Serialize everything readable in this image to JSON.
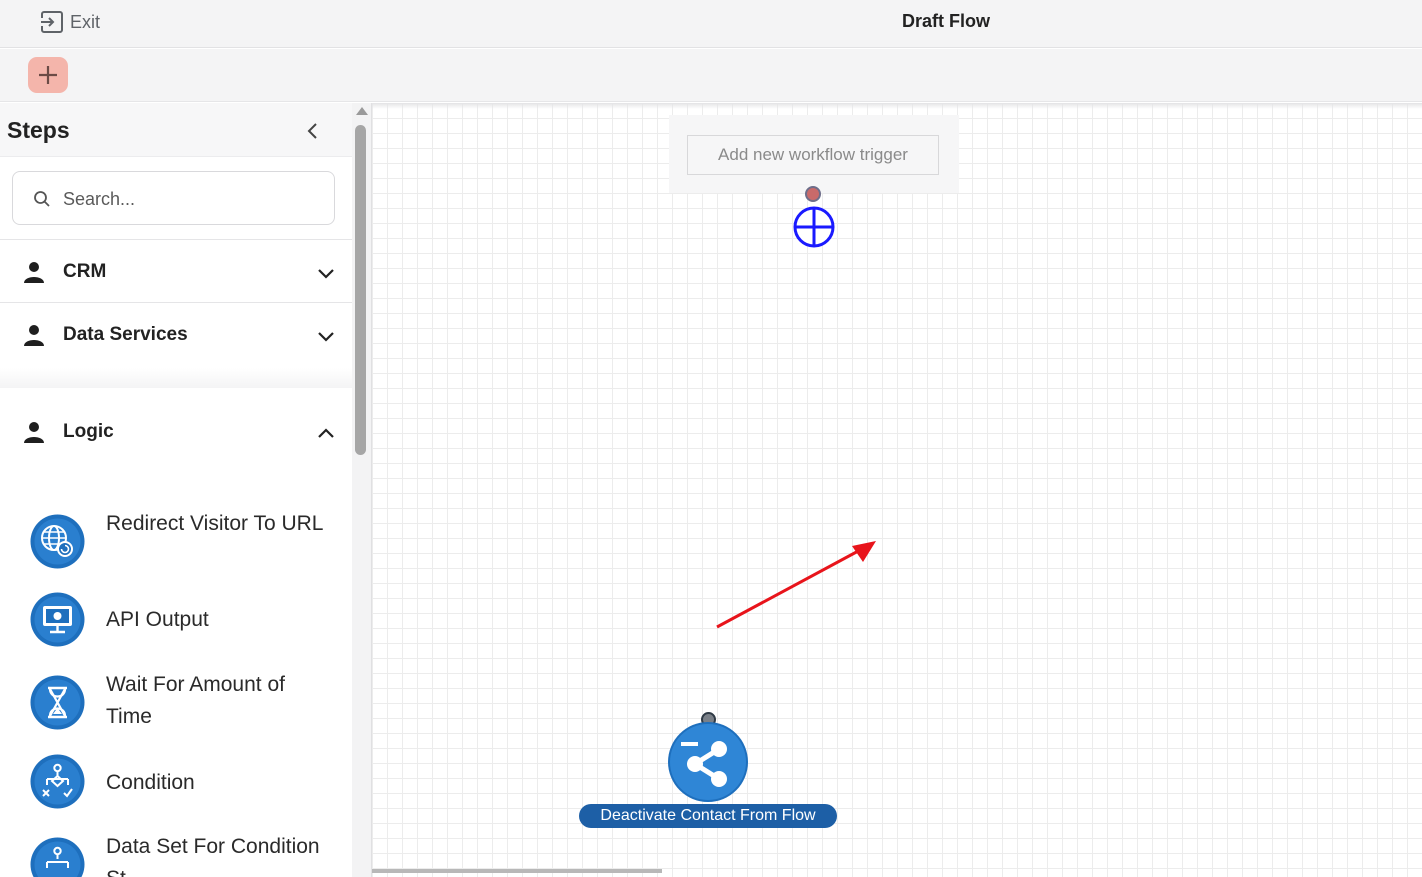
{
  "header": {
    "exit_label": "Exit",
    "title": "Draft Flow"
  },
  "toolbar": {
    "add_icon": "plus-icon",
    "accent_color": "#f4b5ab"
  },
  "sidebar": {
    "title": "Steps",
    "search_placeholder": "Search...",
    "categories": [
      {
        "label": "CRM",
        "icon": "person-icon",
        "expanded": false
      },
      {
        "label": "Data Services",
        "icon": "person-icon",
        "expanded": false
      },
      {
        "label": "Logic",
        "icon": "person-icon",
        "expanded": true
      }
    ],
    "steps": [
      {
        "label": "Redirect Visitor To URL",
        "icon": "globe-redirect-icon"
      },
      {
        "label": "API Output",
        "icon": "api-monitor-icon"
      },
      {
        "label": "Wait For Amount of Time",
        "icon": "hourglass-icon"
      },
      {
        "label": "Condition",
        "icon": "condition-branch-icon"
      },
      {
        "label": "Data Set For Condition St",
        "icon": "data-set-branch-icon"
      }
    ]
  },
  "canvas": {
    "trigger_button_label": "Add new workflow trigger",
    "node": {
      "label": "Deactivate Contact From Flow",
      "icon": "share-deactivate-icon",
      "color": "#1e6fbd"
    }
  },
  "colors": {
    "step_icon_blue": "#1e6fbd",
    "add_node_blue": "#1a1aff",
    "annotation_arrow": "#e8141b"
  }
}
